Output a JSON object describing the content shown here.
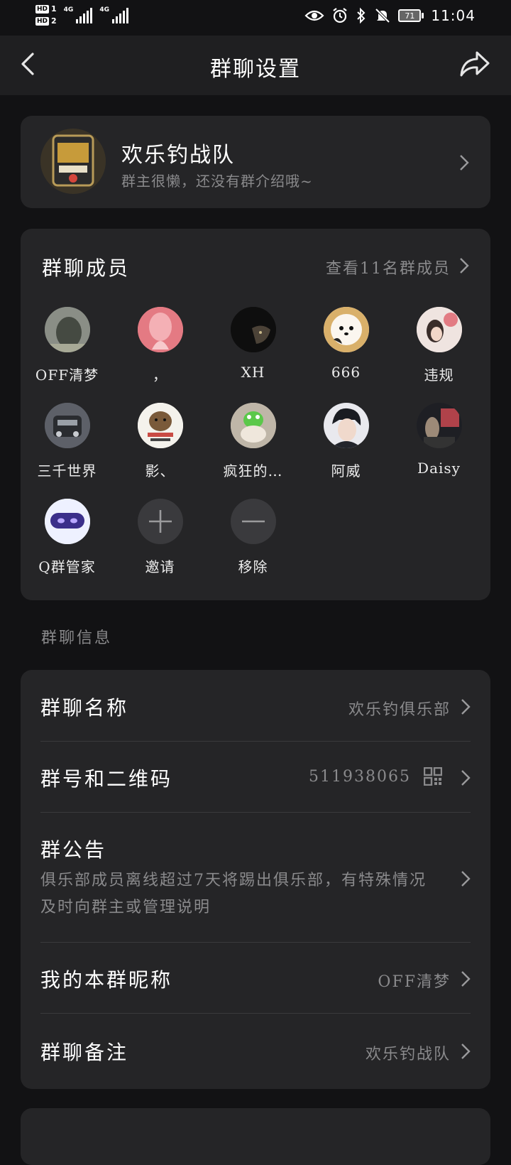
{
  "status_bar": {
    "hd1": "HD",
    "hd1_num": "1",
    "hd2": "HD",
    "hd2_num": "2",
    "net1": "4G",
    "net2": "4G",
    "battery": "71",
    "time": "11:04",
    "icons": [
      "eye-icon",
      "alarm-icon",
      "bluetooth-icon",
      "bell-muted-icon",
      "battery-icon"
    ]
  },
  "nav": {
    "title": "群聊设置",
    "back_icon": "back-arrow-icon",
    "share_icon": "share-icon"
  },
  "group": {
    "name": "欢乐钓战队",
    "description": "群主很懒，还没有群介绍哦~"
  },
  "members": {
    "title": "群聊成员",
    "view_all": "查看11名群成员",
    "list": [
      {
        "name": "OFF清梦",
        "color": "#6b6f68"
      },
      {
        "name": "，",
        "color": "#e8848a"
      },
      {
        "name": "XH",
        "color": "#151515"
      },
      {
        "name": "666",
        "color": "#e9dccb"
      },
      {
        "name": "违规",
        "color": "#d9c3c0"
      },
      {
        "name": "三千世界",
        "color": "#4a4d55"
      },
      {
        "name": "影、",
        "color": "#f2f0ea"
      },
      {
        "name": "疯狂的…",
        "color": "#c7bfb2"
      },
      {
        "name": "阿威",
        "color": "#2f3440"
      },
      {
        "name": "Daisy",
        "color": "#2b2d33"
      },
      {
        "name": "Q群管家",
        "color": "#dfe6ff"
      }
    ],
    "invite_label": "邀请",
    "remove_label": "移除"
  },
  "info": {
    "section_label": "群聊信息",
    "group_name_label": "群聊名称",
    "group_name_value": "欢乐钓俱乐部",
    "group_number_label": "群号和二维码",
    "group_number_value": "511938065",
    "notice_label": "群公告",
    "notice_text": "俱乐部成员离线超过7天将踢出俱乐部，有特殊情况及时向群主或管理说明",
    "nickname_label": "我的本群昵称",
    "nickname_value": "OFF清梦",
    "remark_label": "群聊备注",
    "remark_value": "欢乐钓战队"
  }
}
